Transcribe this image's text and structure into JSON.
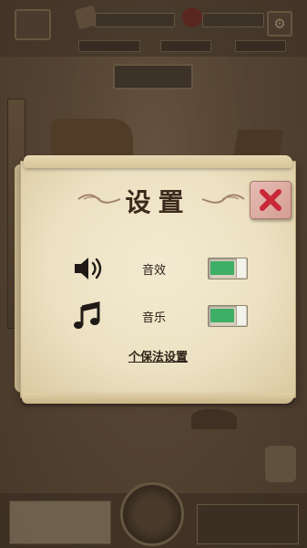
{
  "dialog": {
    "title": "设置",
    "sound_label": "音效",
    "music_label": "音乐",
    "sound_on": 1,
    "music_on": 1,
    "personal_settings_link": "个保法设置"
  },
  "colors": {
    "paper": "#ece1c2",
    "title_text": "#3b2a1c",
    "close_button_bg": "#d49e92",
    "close_x": "#c9283a",
    "toggle_on": "#3fae67"
  },
  "icons": {
    "close": "close-x-icon",
    "sound": "speaker-icon",
    "music": "music-note-icon",
    "settings": "gear-icon"
  }
}
